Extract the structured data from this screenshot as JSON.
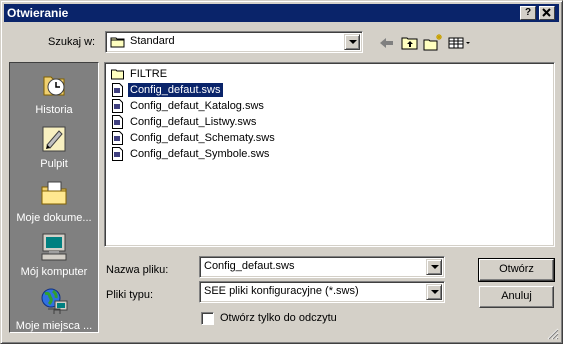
{
  "window": {
    "title": "Otwieranie",
    "help_button": "?",
    "close_button": "✕"
  },
  "look_in": {
    "label": "Szukaj w:",
    "value": "Standard"
  },
  "toolbar": {
    "back_icon": "back-arrow-icon",
    "up_icon": "folder-up-icon",
    "new_folder_icon": "new-folder-icon",
    "view_icon": "view-menu-icon"
  },
  "places": [
    {
      "label": "Historia",
      "icon": "history-icon"
    },
    {
      "label": "Pulpit",
      "icon": "desktop-icon"
    },
    {
      "label": "Moje dokume...",
      "icon": "my-documents-icon"
    },
    {
      "label": "Mój komputer",
      "icon": "my-computer-icon"
    },
    {
      "label": "Moje miejsca ...",
      "icon": "network-places-icon"
    }
  ],
  "files": [
    {
      "name": "FILTRE",
      "type": "folder",
      "selected": false
    },
    {
      "name": "Config_defaut.sws",
      "type": "file",
      "selected": true
    },
    {
      "name": "Config_defaut_Katalog.sws",
      "type": "file",
      "selected": false
    },
    {
      "name": "Config_defaut_Listwy.sws",
      "type": "file",
      "selected": false
    },
    {
      "name": "Config_defaut_Schematy.sws",
      "type": "file",
      "selected": false
    },
    {
      "name": "Config_defaut_Symbole.sws",
      "type": "file",
      "selected": false
    }
  ],
  "filename": {
    "label": "Nazwa pliku:",
    "value": "Config_defaut.sws"
  },
  "filetype": {
    "label": "Pliki typu:",
    "value": "SEE pliki konfiguracyjne (*.sws)"
  },
  "readonly": {
    "label": "Otwórz tylko do odczytu",
    "checked": false
  },
  "buttons": {
    "open": "Otwórz",
    "cancel": "Anuluj"
  },
  "colors": {
    "titlebar": "#0a246a",
    "face": "#d4d0c8",
    "selection": "#0a246a",
    "places_bg": "#808080"
  }
}
